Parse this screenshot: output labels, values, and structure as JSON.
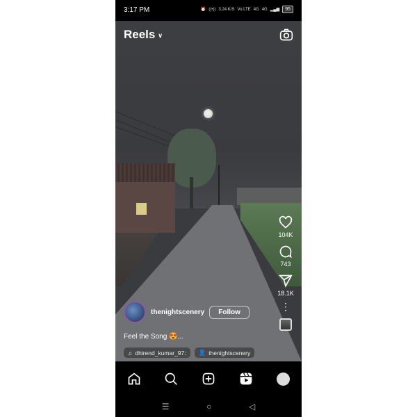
{
  "status_bar": {
    "time": "3:17 PM",
    "speed": "3.24 K/S",
    "volte": "Vo LTE",
    "network1": "4G",
    "network2": "4G",
    "battery": "95"
  },
  "header": {
    "title": "Reels",
    "chevron": "⌄",
    "camera_icon": "camera-icon"
  },
  "actions": {
    "likes": "104K",
    "comments": "743",
    "shares": "18.1K",
    "more": "⋮"
  },
  "post": {
    "username": "thenightscenery",
    "follow_label": "Follow",
    "caption": "Feel the Song 😍...",
    "audio_tag": "dhirend_kumar_97:",
    "people_tag": "thenightscenery"
  },
  "bottom_nav": {
    "items": [
      "home",
      "search",
      "create",
      "reels",
      "profile"
    ]
  },
  "system_nav": {
    "menu": "☰",
    "home": "○",
    "back": "◁"
  },
  "colors": {
    "background": "#000000",
    "sky": "#3a3b3f",
    "text": "#ffffff"
  }
}
